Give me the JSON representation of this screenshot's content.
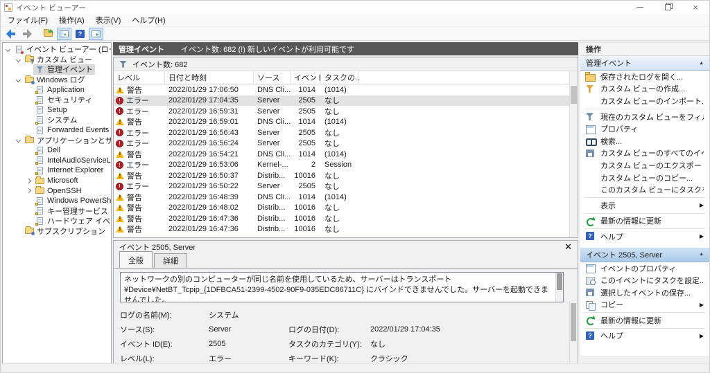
{
  "window": {
    "title": "イベント ビューアー",
    "controls": [
      "minimize",
      "restore",
      "close"
    ]
  },
  "menu": {
    "items": [
      "ファイル(F)",
      "操作(A)",
      "表示(V)",
      "ヘルプ(H)"
    ]
  },
  "toolbar": {
    "buttons": [
      {
        "name": "back",
        "icon": "back-arrow",
        "highlighted": false
      },
      {
        "name": "forward",
        "icon": "forward-arrow",
        "highlighted": false,
        "sep_after": true
      },
      {
        "name": "open-saved-log",
        "icon": "open-folder",
        "highlighted": false
      },
      {
        "name": "show-console-tree",
        "icon": "console-pane",
        "highlighted": true
      },
      {
        "name": "help",
        "icon": "help",
        "highlighted": false
      },
      {
        "name": "show-action-pane",
        "icon": "action-pane",
        "highlighted": true
      }
    ]
  },
  "tree": {
    "items": [
      {
        "label": "イベント ビューアー (ローカル)",
        "level": 0,
        "expander": "expanded",
        "icon": "event-viewer",
        "selected": false
      },
      {
        "label": "カスタム ビュー",
        "level": 1,
        "expander": "expanded",
        "icon": "folder-filter",
        "selected": false
      },
      {
        "label": "管理イベント",
        "level": 2,
        "expander": "none",
        "icon": "filter",
        "selected": true
      },
      {
        "label": "Windows ログ",
        "level": 1,
        "expander": "expanded",
        "icon": "folder-log",
        "selected": false
      },
      {
        "label": "Application",
        "level": 2,
        "expander": "none",
        "icon": "log",
        "selected": false
      },
      {
        "label": "セキュリティ",
        "level": 2,
        "expander": "none",
        "icon": "log",
        "selected": false
      },
      {
        "label": "Setup",
        "level": 2,
        "expander": "none",
        "icon": "log-plain",
        "selected": false
      },
      {
        "label": "システム",
        "level": 2,
        "expander": "none",
        "icon": "log",
        "selected": false
      },
      {
        "label": "Forwarded Events",
        "level": 2,
        "expander": "none",
        "icon": "log-plain",
        "selected": false
      },
      {
        "label": "アプリケーションとサービス ログ",
        "level": 1,
        "expander": "expanded",
        "icon": "folder",
        "selected": false
      },
      {
        "label": "Dell",
        "level": 2,
        "expander": "none",
        "icon": "log",
        "selected": false
      },
      {
        "label": "IntelAudioServiceLog",
        "level": 2,
        "expander": "none",
        "icon": "log",
        "selected": false
      },
      {
        "label": "Internet Explorer",
        "level": 2,
        "expander": "none",
        "icon": "log",
        "selected": false
      },
      {
        "label": "Microsoft",
        "level": 2,
        "expander": "collapsed",
        "icon": "folder",
        "selected": false
      },
      {
        "label": "OpenSSH",
        "level": 2,
        "expander": "collapsed",
        "icon": "folder",
        "selected": false
      },
      {
        "label": "Windows PowerShell",
        "level": 2,
        "expander": "none",
        "icon": "log",
        "selected": false
      },
      {
        "label": "キー管理サービス",
        "level": 2,
        "expander": "none",
        "icon": "log",
        "selected": false
      },
      {
        "label": "ハードウェア イベント",
        "level": 2,
        "expander": "none",
        "icon": "log",
        "selected": false
      },
      {
        "label": "サブスクリプション",
        "level": 1,
        "expander": "none",
        "icon": "subscription",
        "selected": false
      }
    ]
  },
  "main": {
    "header": {
      "title": "管理イベント",
      "subtitle": "イベント数: 682 (!) 新しいイベントが利用可能です"
    },
    "filter_label": "イベント数: 682",
    "columns": [
      "レベル",
      "日付と時刻",
      "ソース",
      "イベント ...",
      "タスクの..."
    ],
    "rows": [
      {
        "type": "warning",
        "level": "警告",
        "datetime": "2022/01/29 17:06:50",
        "source": "DNS Cli...",
        "event_id": "1014",
        "task": "(1014)",
        "selected": false
      },
      {
        "type": "error",
        "level": "エラー",
        "datetime": "2022/01/29 17:04:35",
        "source": "Server",
        "event_id": "2505",
        "task": "なし",
        "selected": true
      },
      {
        "type": "error",
        "level": "エラー",
        "datetime": "2022/01/29 16:59:31",
        "source": "Server",
        "event_id": "2505",
        "task": "なし",
        "selected": false
      },
      {
        "type": "warning",
        "level": "警告",
        "datetime": "2022/01/29 16:59:01",
        "source": "DNS Cli...",
        "event_id": "1014",
        "task": "(1014)",
        "selected": false
      },
      {
        "type": "error",
        "level": "エラー",
        "datetime": "2022/01/29 16:56:43",
        "source": "Server",
        "event_id": "2505",
        "task": "なし",
        "selected": false
      },
      {
        "type": "error",
        "level": "エラー",
        "datetime": "2022/01/29 16:56:24",
        "source": "Server",
        "event_id": "2505",
        "task": "なし",
        "selected": false
      },
      {
        "type": "warning",
        "level": "警告",
        "datetime": "2022/01/29 16:54:21",
        "source": "DNS Cli...",
        "event_id": "1014",
        "task": "(1014)",
        "selected": false
      },
      {
        "type": "error",
        "level": "エラー",
        "datetime": "2022/01/29 16:53:06",
        "source": "Kernel-...",
        "event_id": "2",
        "task": "Session",
        "selected": false
      },
      {
        "type": "warning",
        "level": "警告",
        "datetime": "2022/01/29 16:50:37",
        "source": "Distrib...",
        "event_id": "10016",
        "task": "なし",
        "selected": false
      },
      {
        "type": "error",
        "level": "エラー",
        "datetime": "2022/01/29 16:50:22",
        "source": "Server",
        "event_id": "2505",
        "task": "なし",
        "selected": false
      },
      {
        "type": "warning",
        "level": "警告",
        "datetime": "2022/01/29 16:48:39",
        "source": "DNS Cli...",
        "event_id": "1014",
        "task": "(1014)",
        "selected": false
      },
      {
        "type": "warning",
        "level": "警告",
        "datetime": "2022/01/29 16:48:02",
        "source": "Distrib...",
        "event_id": "10016",
        "task": "なし",
        "selected": false
      },
      {
        "type": "warning",
        "level": "警告",
        "datetime": "2022/01/29 16:47:36",
        "source": "Distrib...",
        "event_id": "10016",
        "task": "なし",
        "selected": false
      },
      {
        "type": "warning",
        "level": "警告",
        "datetime": "2022/01/29 16:47:36",
        "source": "Distrib...",
        "event_id": "10016",
        "task": "なし",
        "selected": false
      }
    ],
    "detail": {
      "title": "イベント 2505, Server",
      "tabs": [
        {
          "label": "全般",
          "active": true
        },
        {
          "label": "詳細",
          "active": false
        }
      ],
      "message": "ネットワークの別のコンピューターが同じ名前を使用しているため、サーバーはトランスポート ¥Device¥NetBT_Tcpip_{1DFBCA51-2399-4502-90F9-035EDC86711C} にバインドできませんでした。サーバーを起動できませんでした。",
      "fields": [
        {
          "l1": "ログの名前(M):",
          "v1": "システム",
          "l2": "",
          "v2": ""
        },
        {
          "l1": "ソース(S):",
          "v1": "Server",
          "l2": "ログの日付(D):",
          "v2": "2022/01/29 17:04:35"
        },
        {
          "l1": "イベント ID(E):",
          "v1": "2505",
          "l2": "タスクのカテゴリ(Y):",
          "v2": "なし"
        },
        {
          "l1": "レベル(L):",
          "v1": "エラー",
          "l2": "キーワード(K):",
          "v2": "クラシック"
        }
      ]
    }
  },
  "actions": {
    "title": "操作",
    "sections": [
      {
        "header": "管理イベント",
        "items": [
          {
            "label": "保存されたログを開く...",
            "icon": "open-folder"
          },
          {
            "label": "カスタム ビューの作成...",
            "icon": "filter-create"
          },
          {
            "label": "カスタム ビューのインポート...",
            "icon": "blank"
          },
          {
            "label": "現在のカスタム ビューをフィルター...",
            "icon": "filter",
            "sep_before": true
          },
          {
            "label": "プロパティ",
            "icon": "properties"
          },
          {
            "label": "検索...",
            "icon": "find"
          },
          {
            "label": "カスタム ビューのすべてのイベントを名...",
            "icon": "save"
          },
          {
            "label": "カスタム ビューのエクスポート...",
            "icon": "blank"
          },
          {
            "label": "カスタム ビューのコピー...",
            "icon": "blank"
          },
          {
            "label": "このカスタム ビューにタスクを設定...",
            "icon": "blank"
          },
          {
            "label": "表示",
            "icon": "blank",
            "submenu": true,
            "sep_before": true
          },
          {
            "label": "最新の情報に更新",
            "icon": "refresh",
            "sep_before": true
          },
          {
            "label": "ヘルプ",
            "icon": "help",
            "submenu": true,
            "sep_before": true
          }
        ]
      },
      {
        "header": "イベント 2505, Server",
        "items": [
          {
            "label": "イベントのプロパティ",
            "icon": "properties"
          },
          {
            "label": "このイベントにタスクを設定...",
            "icon": "task"
          },
          {
            "label": "選択したイベントの保存...",
            "icon": "save"
          },
          {
            "label": "コピー",
            "icon": "copy",
            "submenu": true
          },
          {
            "label": "最新の情報に更新",
            "icon": "refresh",
            "sep_before": true
          },
          {
            "label": "ヘルプ",
            "icon": "help",
            "submenu": true,
            "sep_before": true
          }
        ]
      }
    ]
  }
}
